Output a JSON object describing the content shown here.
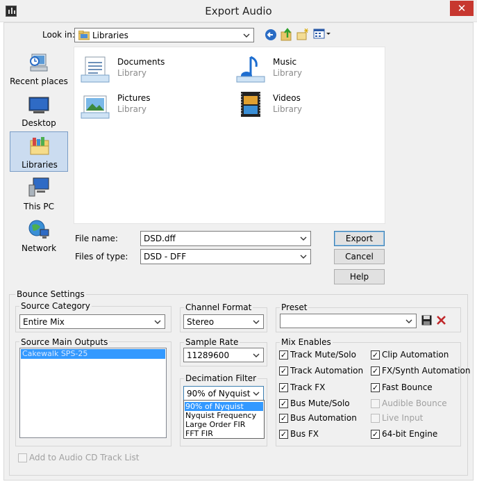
{
  "window": {
    "title": "Export Audio",
    "close_glyph": "✕"
  },
  "lookin": {
    "label": "Look in:",
    "value": "Libraries",
    "icons": [
      "back-icon",
      "up-folder-icon",
      "new-folder-icon",
      "view-menu-icon"
    ]
  },
  "places": [
    {
      "label": "Recent places",
      "icon": "recent-places-icon"
    },
    {
      "label": "Desktop",
      "icon": "desktop-icon"
    },
    {
      "label": "Libraries",
      "icon": "libraries-icon",
      "selected": true
    },
    {
      "label": "This PC",
      "icon": "this-pc-icon"
    },
    {
      "label": "Network",
      "icon": "network-icon"
    }
  ],
  "files": [
    {
      "name": "Documents",
      "sub": "Library"
    },
    {
      "name": "Music",
      "sub": "Library"
    },
    {
      "name": "Pictures",
      "sub": "Library"
    },
    {
      "name": "Videos",
      "sub": "Library"
    }
  ],
  "filename": {
    "label": "File name:",
    "value": "DSD.dff"
  },
  "filetype": {
    "label": "Files of type:",
    "value": "DSD - DFF"
  },
  "buttons": {
    "export": "Export",
    "cancel": "Cancel",
    "help": "Help"
  },
  "bounce": {
    "title": "Bounce Settings",
    "source_category": {
      "label": "Source Category",
      "value": "Entire Mix"
    },
    "source_outputs": {
      "label": "Source Main Outputs",
      "items": [
        "Cakewalk SPS-25"
      ]
    },
    "channel_format": {
      "label": "Channel Format",
      "value": "Stereo"
    },
    "sample_rate": {
      "label": "Sample Rate",
      "value": "11289600"
    },
    "decimation": {
      "label": "Decimation Filter",
      "value": "90% of Nyquist",
      "options": [
        "90% of Nyquist",
        "Nyquist Frequency",
        "Large Order FIR",
        "FFT FIR"
      ],
      "selected_index": 0
    },
    "preset": {
      "label": "Preset",
      "value": ""
    },
    "mix_enables": {
      "label": "Mix Enables",
      "left": [
        {
          "label": "Track Mute/Solo",
          "checked": true,
          "enabled": true
        },
        {
          "label": "Track Automation",
          "checked": true,
          "enabled": true
        },
        {
          "label": "Track FX",
          "checked": true,
          "enabled": true
        },
        {
          "label": "Bus Mute/Solo",
          "checked": true,
          "enabled": true
        },
        {
          "label": "Bus Automation",
          "checked": true,
          "enabled": true
        },
        {
          "label": "Bus FX",
          "checked": true,
          "enabled": true
        }
      ],
      "right": [
        {
          "label": "Clip Automation",
          "checked": true,
          "enabled": true
        },
        {
          "label": "FX/Synth Automation",
          "checked": true,
          "enabled": true
        },
        {
          "label": "Fast Bounce",
          "checked": true,
          "enabled": true
        },
        {
          "label": "Audible Bounce",
          "checked": false,
          "enabled": false
        },
        {
          "label": "Live Input",
          "checked": false,
          "enabled": false
        },
        {
          "label": "64-bit Engine",
          "checked": true,
          "enabled": true
        }
      ]
    },
    "add_to_cd": {
      "label": "Add to Audio CD Track List",
      "checked": false,
      "enabled": false
    }
  },
  "colors": {
    "selection": "#3399ff",
    "close": "#c7372f",
    "places_selected": "#cbdcf0"
  }
}
